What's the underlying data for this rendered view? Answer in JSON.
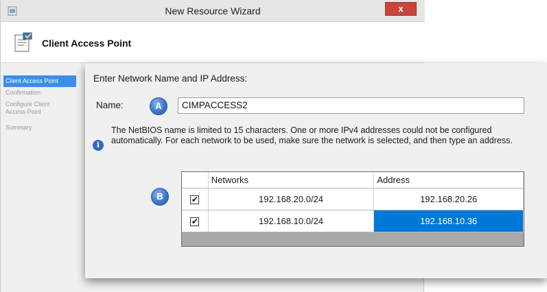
{
  "window": {
    "title": "New Resource Wizard",
    "close_label": "x"
  },
  "header": {
    "title": "Client Access Point",
    "icon": "wizard-page-icon"
  },
  "sidebar": {
    "steps": [
      {
        "label": "Client Access Point",
        "active": true
      },
      {
        "label": "Confirmation",
        "active": false
      },
      {
        "label": "Configure Client Access Point",
        "active": false
      },
      {
        "label": "Summary",
        "active": false
      }
    ]
  },
  "panel": {
    "instruction": "Enter Network Name and IP Address:",
    "name_label": "Name:",
    "name_value": "CIMPACCESS2",
    "badge_a": "A",
    "badge_b": "B",
    "info_icon": "info-icon",
    "info_text": "The NetBIOS name is limited to 15 characters.  One or more IPv4 addresses could not be configured automatically.  For each network to be used, make sure the network is selected, and then type an address."
  },
  "network_table": {
    "columns": [
      "",
      "Networks",
      "Address"
    ],
    "rows": [
      {
        "checked": true,
        "network": "192.168.20.0/24",
        "address": "192.168.20.26",
        "selected": false
      },
      {
        "checked": true,
        "network": "192.168.10.0/24",
        "address": "192.168.10.36",
        "selected": true
      }
    ]
  },
  "colors": {
    "accent": "#0078d7",
    "badge": "#3f76c9",
    "close": "#c7463c"
  }
}
